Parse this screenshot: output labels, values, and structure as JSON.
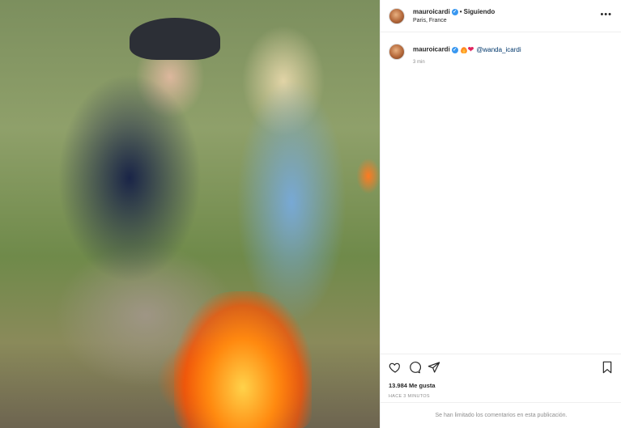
{
  "photo": {
    "alt_icon": "photo"
  },
  "header": {
    "username": "mauroicardi",
    "separator": "•",
    "follow_status": "Siguiendo",
    "location": "Paris, France",
    "more": "•••"
  },
  "caption": {
    "username": "mauroicardi",
    "mention": "@wanda_icardi",
    "heart": "❤",
    "time": "3 min"
  },
  "actions": {
    "likes": "13.984 Me gusta",
    "time_ago": "HACE 3 MINUTOS"
  },
  "footer": {
    "comments_disabled": "Se han limitado los comentarios en esta publicación."
  },
  "colors": {
    "verified": "#3897f0",
    "mention": "#00376b",
    "muted": "#8e8e8e"
  }
}
